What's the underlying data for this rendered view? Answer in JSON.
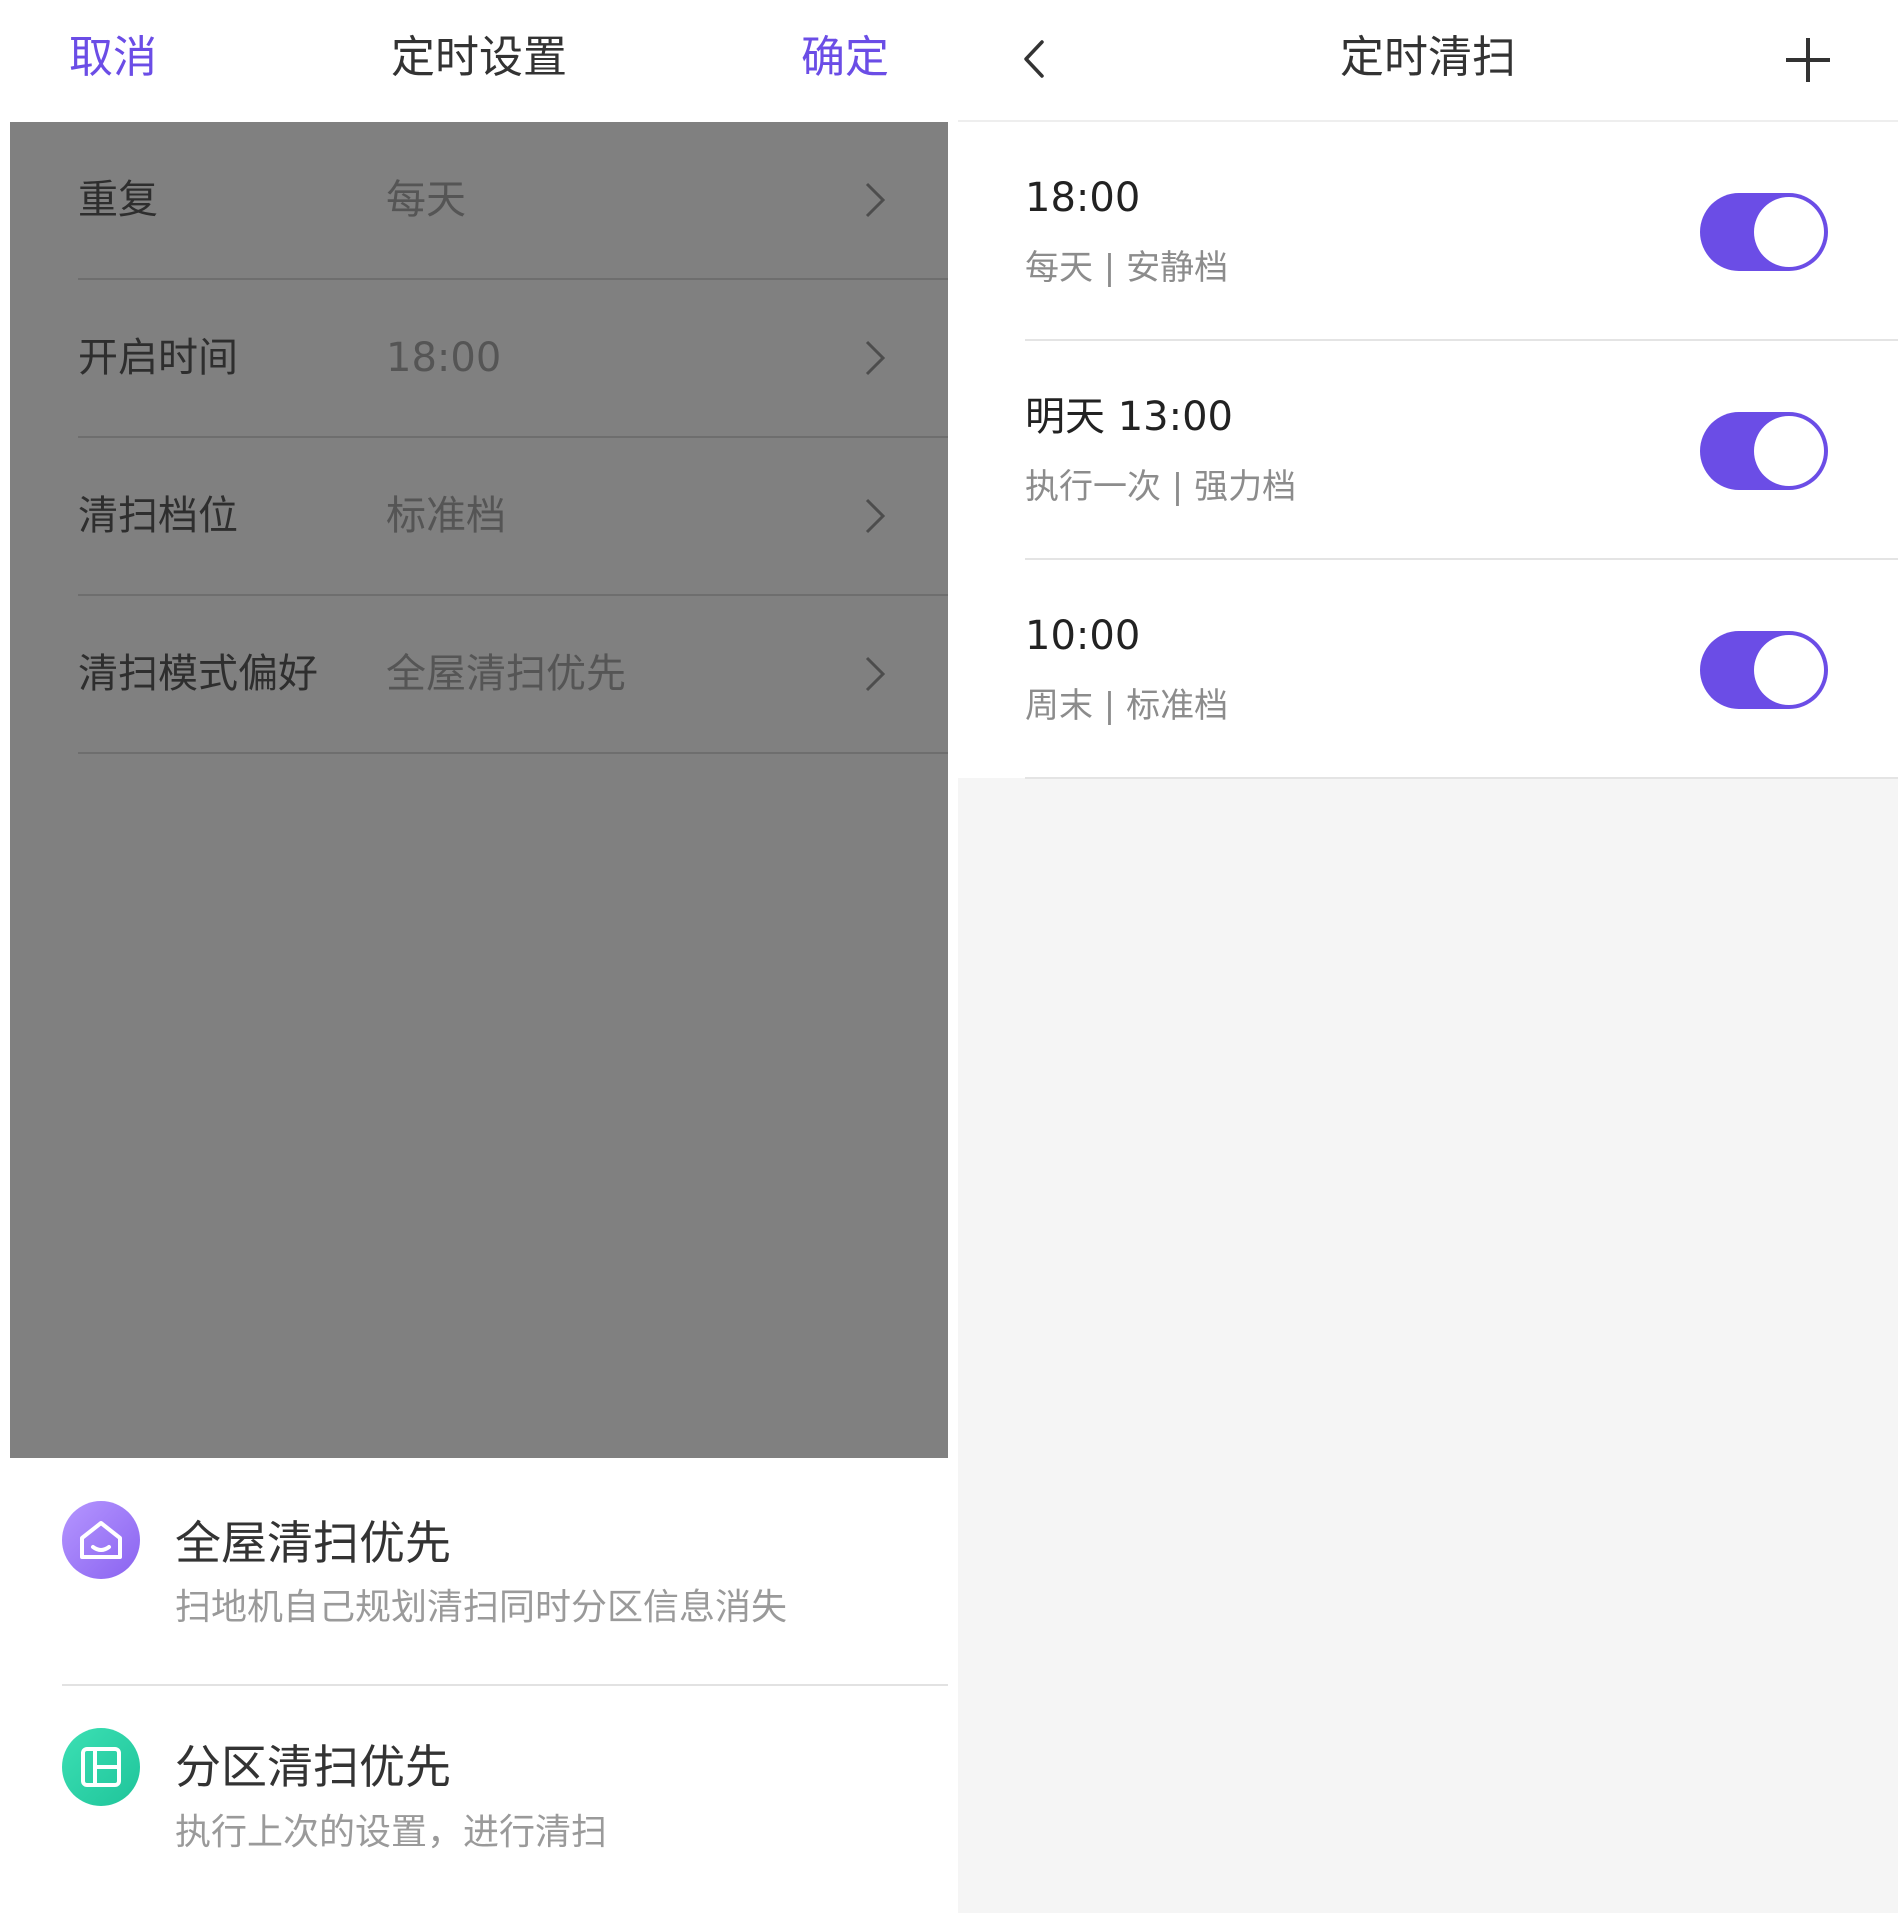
{
  "left": {
    "header": {
      "cancel_label": "取消",
      "title": "定时设置",
      "confirm_label": "确定"
    },
    "settings": [
      {
        "label": "重复",
        "value": "每天"
      },
      {
        "label": "开启时间",
        "value": "18:00"
      },
      {
        "label": "清扫档位",
        "value": "标准档"
      },
      {
        "label": "清扫模式偏好",
        "value": "全屋清扫优先"
      }
    ],
    "sheet": {
      "options": [
        {
          "icon": "house-icon",
          "title": "全屋清扫优先",
          "desc": "扫地机自己规划清扫同时分区信息消失",
          "color": "#9b7bf5"
        },
        {
          "icon": "zones-icon",
          "title": "分区清扫优先",
          "desc": "执行上次的设置，进行清扫",
          "color": "#2ed3a8"
        }
      ]
    }
  },
  "right": {
    "header": {
      "back_icon": "chevron-left-icon",
      "title": "定时清扫",
      "add_icon": "plus-icon"
    },
    "schedules": [
      {
        "time": "18:00",
        "desc": "每天 | 安静档",
        "enabled": true
      },
      {
        "time": "明天 13:00",
        "desc": "执行一次 | 强力档",
        "enabled": true
      },
      {
        "time": "10:00",
        "desc": "周末 | 标准档",
        "enabled": true
      }
    ]
  },
  "colors": {
    "accent": "#6b4de6",
    "overlay": "#808080",
    "zone_icon": "#2ed3a8",
    "house_icon": "#9b7bf5"
  }
}
